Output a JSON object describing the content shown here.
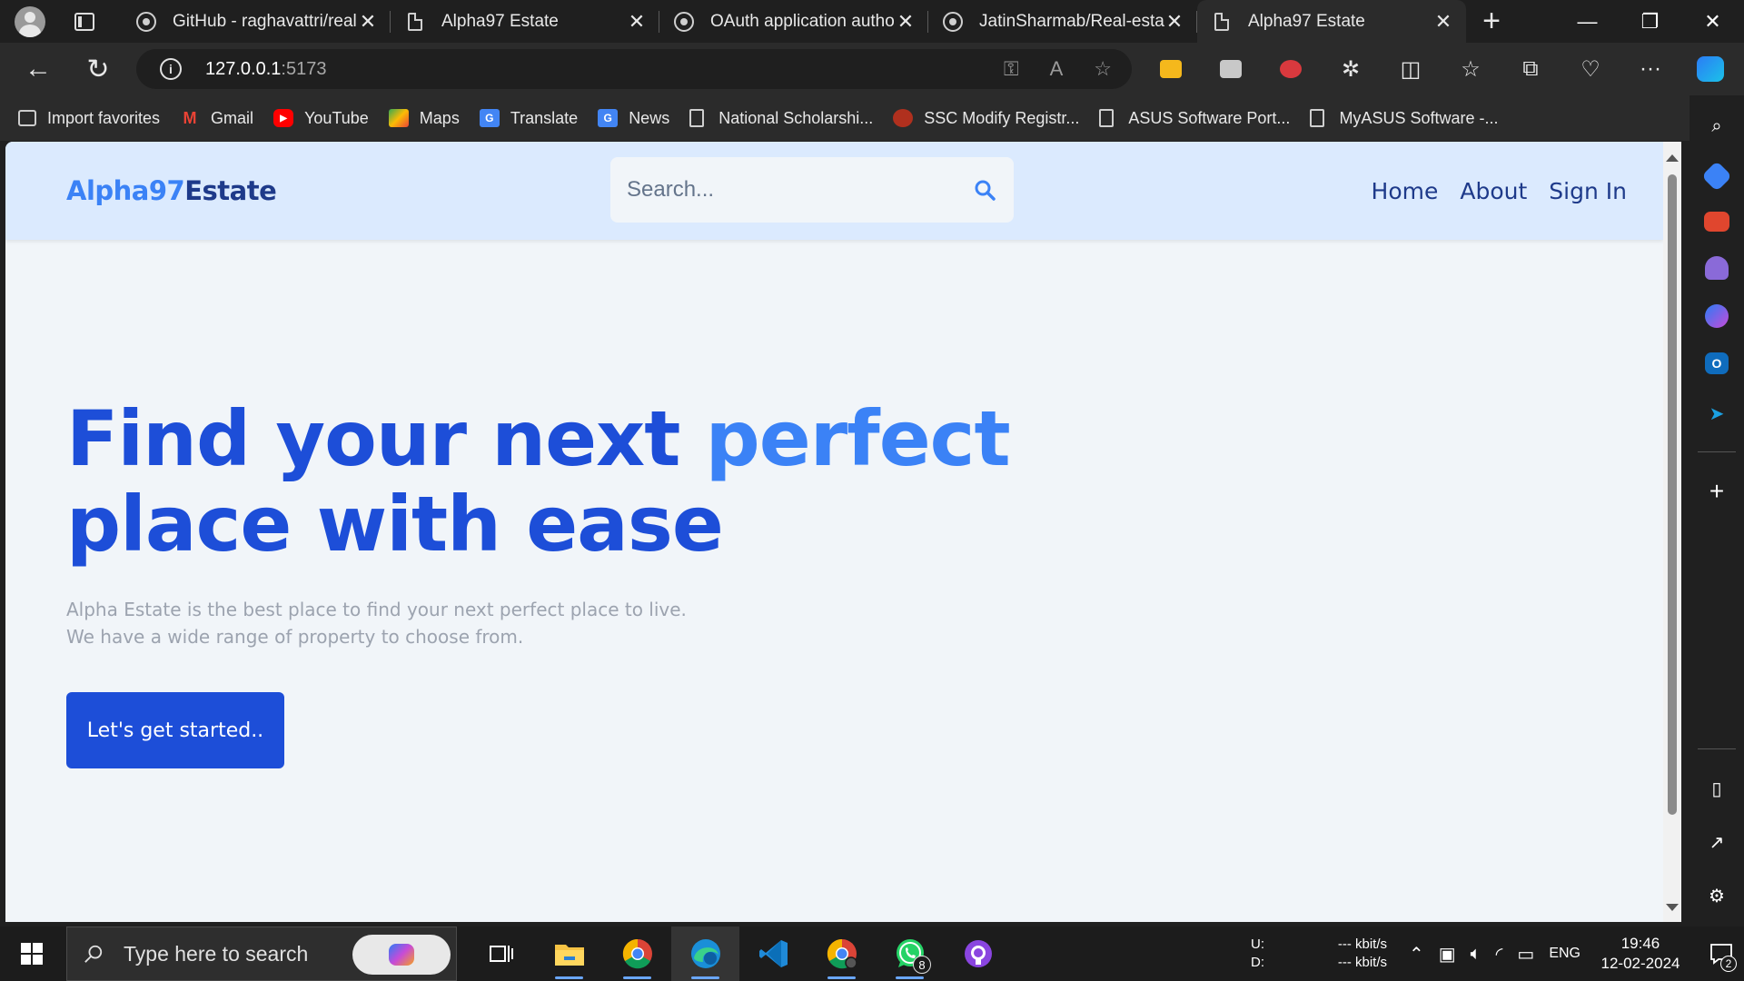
{
  "browser": {
    "tabs": [
      {
        "label": "GitHub - raghavattri/real",
        "icon": "github-icon",
        "active": false
      },
      {
        "label": "Alpha97 Estate",
        "icon": "page-icon",
        "active": false
      },
      {
        "label": "OAuth application autho",
        "icon": "github-icon",
        "active": false
      },
      {
        "label": "JatinSharmab/Real-estate",
        "icon": "github-icon",
        "active": false
      },
      {
        "label": "Alpha97 Estate",
        "icon": "page-icon",
        "active": true
      }
    ],
    "url_host": "127.0.0.1",
    "url_port": ":5173",
    "favorites": [
      {
        "label": "Import favorites",
        "icon": "import-icon"
      },
      {
        "label": "Gmail",
        "icon": "gmail-icon",
        "color": "#ea4335"
      },
      {
        "label": "YouTube",
        "icon": "youtube-icon",
        "color": "#ff0000"
      },
      {
        "label": "Maps",
        "icon": "maps-icon",
        "color": "#34a853"
      },
      {
        "label": "Translate",
        "icon": "translate-icon",
        "color": "#4285f4"
      },
      {
        "label": "News",
        "icon": "news-icon",
        "color": "#4285f4"
      },
      {
        "label": "National Scholarshi...",
        "icon": "page-icon"
      },
      {
        "label": "SSC Modify Registr...",
        "icon": "ssc-icon",
        "color": "#b0301e"
      },
      {
        "label": "ASUS Software Port...",
        "icon": "page-icon"
      },
      {
        "label": "MyASUS Software -...",
        "icon": "page-icon"
      }
    ]
  },
  "site": {
    "logo_part1": "Alpha97",
    "logo_part2": "Estate",
    "search_placeholder": "Search...",
    "nav": {
      "home": "Home",
      "about": "About",
      "signin": "Sign In"
    },
    "hero": {
      "title_part1": "Find your next ",
      "title_accent": "perfect",
      "title_part2": "place with ease",
      "line1": "Alpha Estate is the best place to find your next perfect place to live.",
      "line2": "We have a wide range of property to choose from.",
      "cta": "Let's get started.."
    },
    "colors": {
      "primary": "#1d4ed8",
      "accent": "#3b82f6",
      "header_bg": "#dbeafe",
      "page_bg": "#f1f5f9"
    }
  },
  "taskbar": {
    "search_placeholder": "Type here to search",
    "apps": [
      "task-view-icon",
      "file-explorer-icon",
      "chrome-icon",
      "edge-icon",
      "vscode-icon",
      "chrome-profile-icon",
      "whatsapp-icon",
      "github-desktop-icon"
    ],
    "whatsapp_badge": "8",
    "net_up_label": "U:",
    "net_down_label": "D:",
    "net_up_value": "--- kbit/s",
    "net_down_value": "--- kbit/s",
    "language": "ENG",
    "time": "19:46",
    "date": "12-02-2024",
    "notification_count": "2"
  }
}
